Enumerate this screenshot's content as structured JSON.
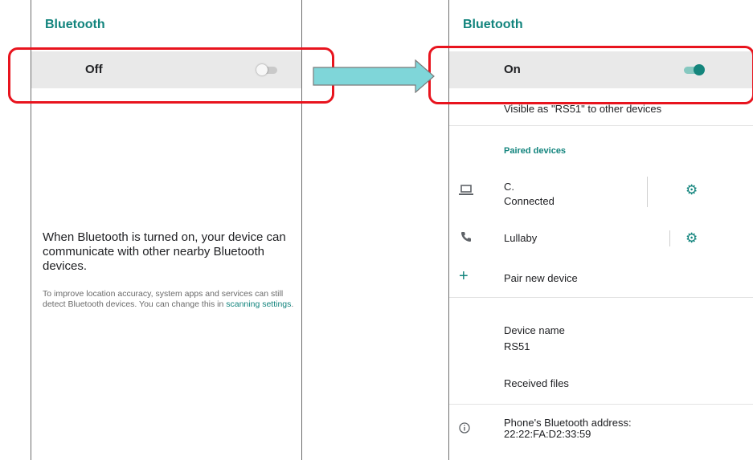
{
  "left_screen": {
    "title": "Bluetooth",
    "toggle_label": "Off",
    "toggle_state": "off",
    "info_main": "When Bluetooth is turned on, your device can communicate with other nearby Bluetooth devices.",
    "info_sub_prefix": "To improve location accuracy, system apps and services can still detect Bluetooth devices. You can change this in ",
    "info_sub_link": "scanning settings",
    "info_sub_suffix": "."
  },
  "right_screen": {
    "title": "Bluetooth",
    "toggle_label": "On",
    "toggle_state": "on",
    "visible_as": "Visible as \"RS51\" to other devices",
    "section_paired": "Paired devices",
    "devices": [
      {
        "name": "C.",
        "status": "Connected",
        "icon": "laptop-icon"
      },
      {
        "name": "Lullaby",
        "status": "",
        "icon": "phone-icon"
      }
    ],
    "pair_new": "Pair new device",
    "device_name_label": "Device name",
    "device_name_value": "RS51",
    "received_files": "Received files",
    "address_label": "Phone's Bluetooth address:",
    "address_value": "22:22:FA:D2:33:59"
  },
  "colors": {
    "accent": "#12847d",
    "highlight": "#e8141e",
    "arrow_fill": "#7fd6d9"
  }
}
